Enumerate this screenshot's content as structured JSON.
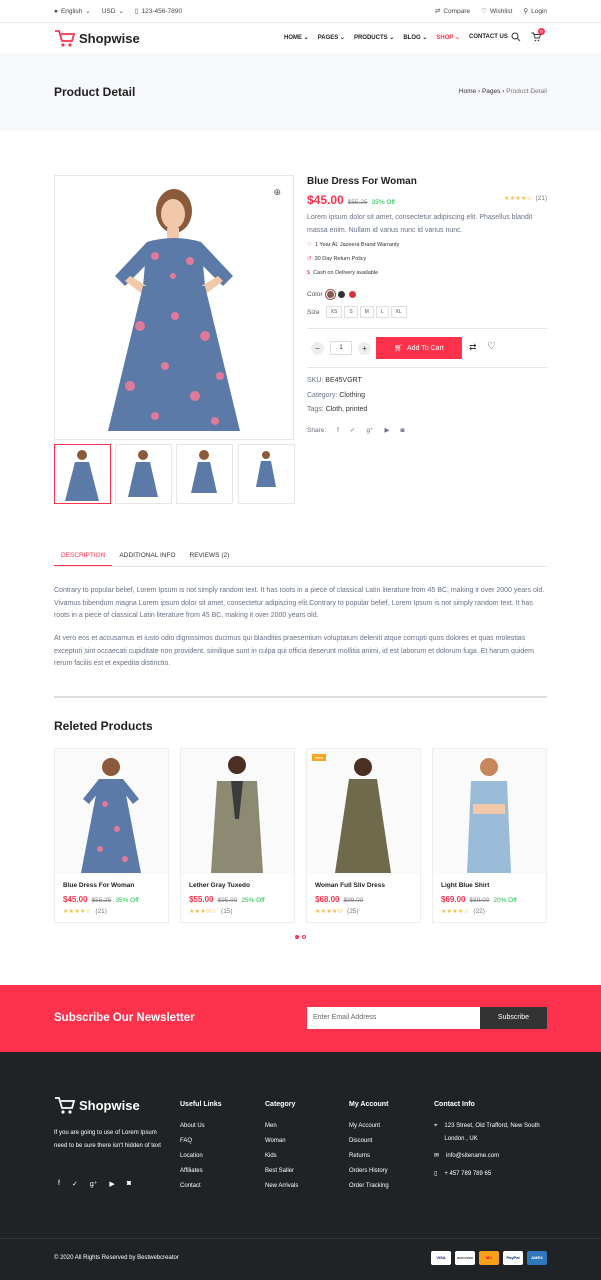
{
  "topbar": {
    "language": "English",
    "currency": "USD",
    "phone": "123-456-7890",
    "compare": "Compare",
    "wishlist": "Wishlist",
    "login": "Login"
  },
  "header": {
    "logo": "Shopwise",
    "nav": [
      "HOME",
      "PAGES",
      "PRODUCTS",
      "BLOG",
      "SHOP",
      "CONTACT US"
    ],
    "cart_count": "0"
  },
  "page_title": "Product Detail",
  "breadcrumb": {
    "home": "Home",
    "pages": "Pages",
    "current": "Product Detail"
  },
  "product": {
    "title": "Blue Dress For Woman",
    "price": "$45.00",
    "old_price": "$55.25",
    "discount": "35% Off",
    "rating_count": "(21)",
    "description": "Lorem ipsum dolor sit amet, consectetur adipiscing elit. Phasellus blandit massa enim. Nullam id varius nunc id varius nunc.",
    "features": [
      "1 Year AL Jazeera Brand Warranty",
      "30 Day Return Policy",
      "Cash on Delivery available"
    ],
    "color_label": "Color",
    "colors": [
      "#87554b",
      "#333333",
      "#da323f"
    ],
    "size_label": "Size",
    "sizes": [
      "XS",
      "S",
      "M",
      "L",
      "XL"
    ],
    "quantity": "1",
    "add_to_cart": "Add To Cart",
    "sku_label": "SKU:",
    "sku": "BE45VGRT",
    "category_label": "Category:",
    "category": "Clothing",
    "tags_label": "Tags:",
    "tags": "Cloth, printed",
    "share_label": "Share:"
  },
  "tabs": [
    "DESCRIPTION",
    "ADDITIONAL INFO",
    "REVIEWS (2)"
  ],
  "description_paragraphs": [
    "Contrary to popular belief, Lorem Ipsum is not simply random text. It has roots in a piece of classical Latin literature from 45 BC, making it over 2000 years old. Vivamus bibendum magna Lorem ipsum dolor sit amet, consectetur adipiscing elit.Contrary to popular belief, Lorem Ipsum is not simply random text. It has roots in a piece of classical Latin literature from 45 BC, making it over 2000 years old.",
    "At vero eos et accusamus et iusto odio dignissimos ducimus qui blanditiis praesentium voluptatum deleniti atque corrupti quos dolores et quas molestias excepturi sint occaecati cupiditate non provident, similique sunt in culpa qui officia deserunt mollitia animi, id est laborum et dolorum fuga. Et harum quidem rerum facilis est et expedita distinctio."
  ],
  "related": {
    "heading": "Releted Products",
    "items": [
      {
        "name": "Blue Dress For Woman",
        "price": "$45.00",
        "old": "$55.25",
        "off": "35% Off",
        "count": "(21)",
        "stars": 4,
        "badge": ""
      },
      {
        "name": "Lether Gray Tuxedo",
        "price": "$55.00",
        "old": "$95.00",
        "off": "25% Off",
        "count": "(15)",
        "stars": 3.5,
        "badge": ""
      },
      {
        "name": "Woman Full Sliv Dress",
        "price": "$68.00",
        "old": "$99.00",
        "off": "",
        "count": "(25)",
        "stars": 4.5,
        "badge": "New"
      },
      {
        "name": "Light Blue Shirt",
        "price": "$69.00",
        "old": "$89.00",
        "off": "20% Off",
        "count": "(22)",
        "stars": 4,
        "badge": ""
      }
    ]
  },
  "newsletter": {
    "heading": "Subscribe Our Newsletter",
    "placeholder": "Enter Email Address",
    "button": "Subscribe"
  },
  "footer": {
    "logo": "Shopwise",
    "about": "If you are going to use of Lorem Ipsum need to be sure there isn't hidden of text",
    "useful_links_heading": "Useful Links",
    "useful_links": [
      "About Us",
      "FAQ",
      "Location",
      "Affiliates",
      "Contact"
    ],
    "category_heading": "Category",
    "category": [
      "Men",
      "Woman",
      "Kids",
      "Best Saller",
      "New Arrivals"
    ],
    "account_heading": "My Account",
    "account": [
      "My Account",
      "Discount",
      "Returns",
      "Orders History",
      "Order Tracking"
    ],
    "contact_heading": "Contact Info",
    "address": "123 Street, Old Trafford, New South London , UK",
    "email": "info@sitename.com",
    "phone": "+ 457 789 789 65",
    "copyright": "© 2020 All Rights Reserved by Bestwebcreator",
    "payments": [
      "VISA",
      "DISCOVER",
      "MC",
      "PayPal",
      "AMEX"
    ]
  },
  "colors": {
    "accent": "#ff324d",
    "dark": "#202325",
    "success": "#16bd42",
    "star": "#f6bc3e"
  }
}
